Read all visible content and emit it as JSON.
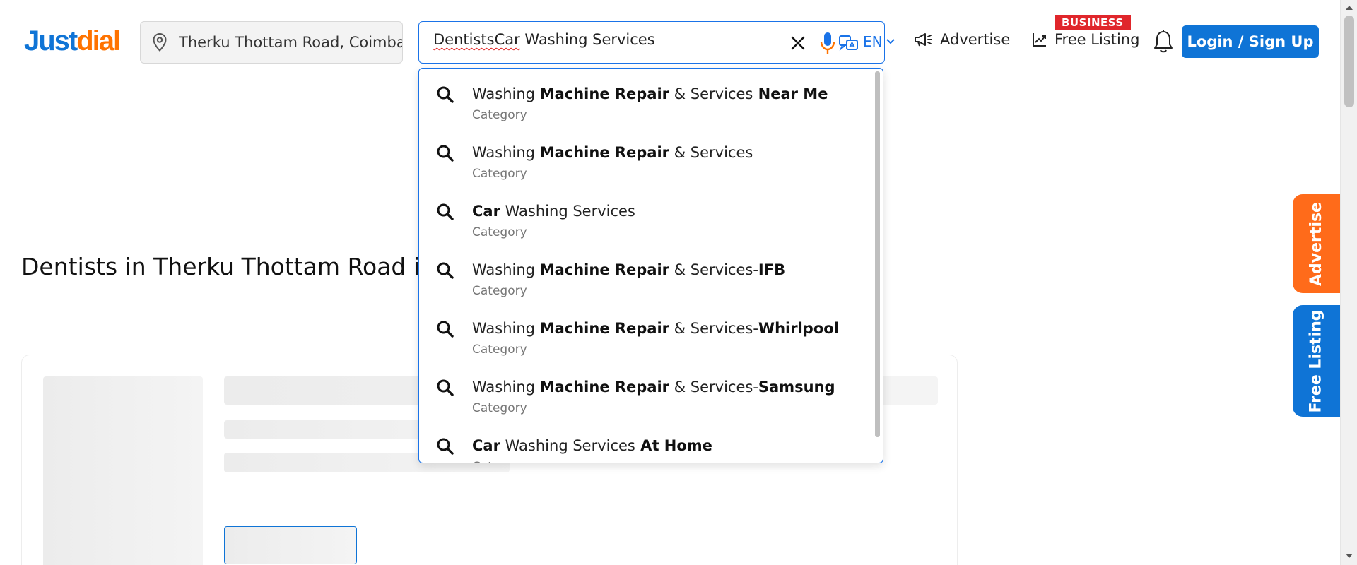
{
  "brand": {
    "logo_part1": "Just",
    "logo_part2": "dial"
  },
  "header": {
    "location_value": "Therku Thottam Road, Coimbatore",
    "search_value_misspelled": "DentistsCar",
    "search_value_rest": " Washing Services",
    "language": "EN",
    "advertise_label": "Advertise",
    "free_listing_label": "Free Listing",
    "business_badge": "BUSINESS",
    "login_label": "Login / Sign Up"
  },
  "page": {
    "title": "Dentists in Therku Thottam Road in Coimbatore"
  },
  "side_tabs": {
    "advertise": "Advertise",
    "free_listing": "Free Listing"
  },
  "suggestions": [
    {
      "parts": [
        "Washing ",
        "Machine Repair",
        " & ",
        "Services",
        "",
        " Near Me"
      ],
      "category": "Category"
    },
    {
      "parts": [
        "Washing ",
        "Machine Repair",
        " & ",
        "Services",
        "",
        ""
      ],
      "category": "Category"
    },
    {
      "parts": [
        "",
        "Car",
        " Washing Services",
        "",
        "",
        ""
      ],
      "category": "Category"
    },
    {
      "parts": [
        "Washing ",
        "Machine Repair",
        " & ",
        "Services",
        "-",
        "IFB"
      ],
      "category": "Category"
    },
    {
      "parts": [
        "Washing ",
        "Machine Repair",
        " & ",
        "Services",
        "-",
        "Whirlpool"
      ],
      "category": "Category"
    },
    {
      "parts": [
        "Washing ",
        "Machine Repair",
        " & ",
        "Services",
        "-",
        "Samsung"
      ],
      "category": "Category"
    },
    {
      "parts": [
        "",
        "Car",
        " Washing Services",
        "",
        "",
        " At Home"
      ],
      "category": "Category"
    }
  ],
  "colors": {
    "brand_blue": "#0f74d6",
    "brand_orange": "#ff7300",
    "badge_red": "#e0262b",
    "advertise_orange": "#ff6b1a"
  }
}
